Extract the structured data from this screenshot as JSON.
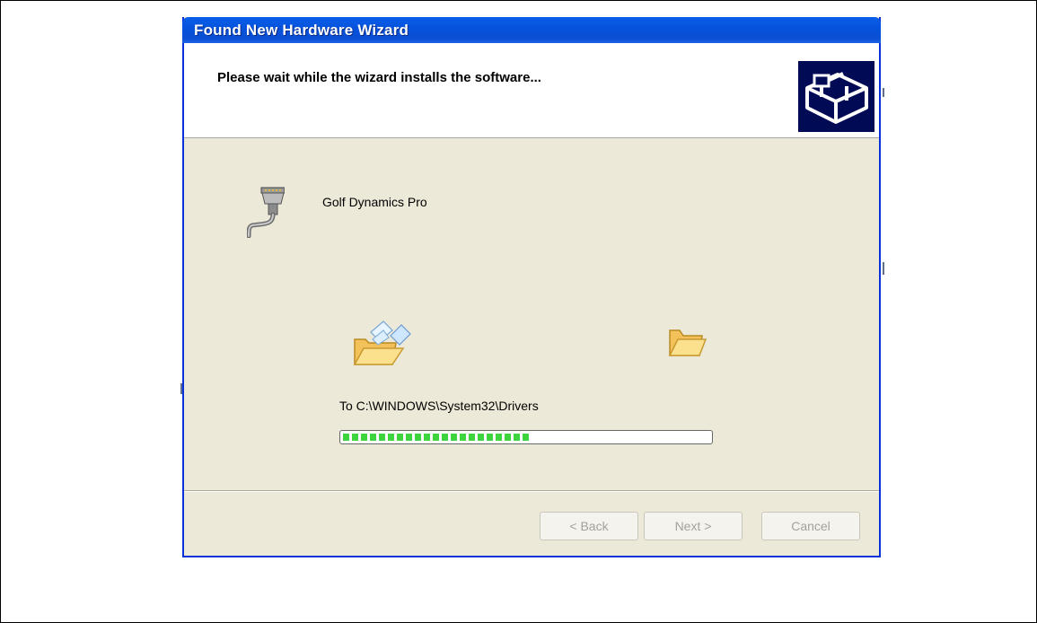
{
  "window": {
    "title": "Found New Hardware Wizard"
  },
  "header": {
    "heading": "Please wait while the wizard installs the software...",
    "icon": "hardware-installer-icon"
  },
  "device": {
    "name": "Golf Dynamics Pro",
    "icon": "serial-connector-icon"
  },
  "copy_animation": {
    "source_icon": "folder-with-flying-papers-icon",
    "dest_icon": "open-folder-icon"
  },
  "status": {
    "destination": "To C:\\WINDOWS\\System32\\Drivers",
    "progress_percent": 51
  },
  "buttons": {
    "back": "< Back",
    "next": "Next >",
    "cancel": "Cancel"
  },
  "colors": {
    "titlebar": "#0553dd",
    "dialog_bg": "#ece9d8",
    "progress": "#3ed43e"
  }
}
